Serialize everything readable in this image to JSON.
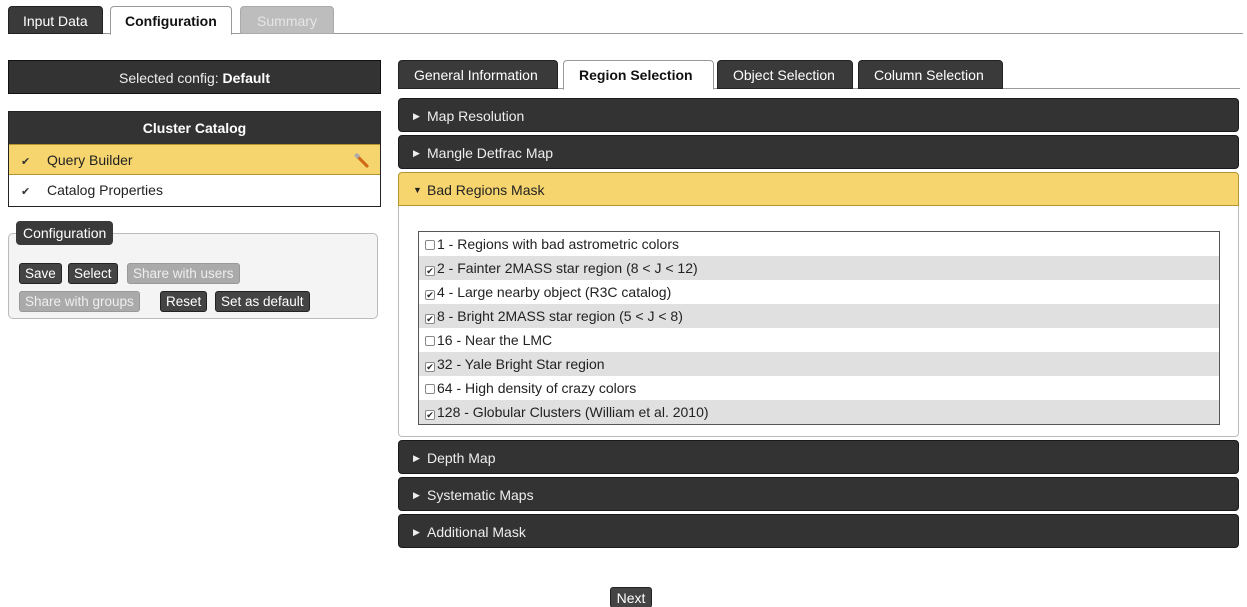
{
  "top_tabs": [
    {
      "label": "Input Data"
    },
    {
      "label": "Configuration"
    },
    {
      "label": "Summary"
    }
  ],
  "selected_config": {
    "prefix": "Selected config:",
    "name": "Default"
  },
  "catalog": {
    "title": "Cluster Catalog",
    "items": [
      {
        "label": "Query Builder",
        "checked": true,
        "active": true,
        "icon": "wrench-icon"
      },
      {
        "label": "Catalog Properties",
        "checked": true,
        "active": false
      }
    ]
  },
  "configuration": {
    "legend": "Configuration",
    "buttons": {
      "save": "Save",
      "select": "Select",
      "share_users": "Share with users",
      "share_groups": "Share with groups",
      "reset": "Reset",
      "set_default": "Set as default"
    }
  },
  "sub_tabs": [
    {
      "label": "General Information"
    },
    {
      "label": "Region Selection"
    },
    {
      "label": "Object Selection"
    },
    {
      "label": "Column Selection"
    }
  ],
  "accordion": [
    {
      "label": "Map Resolution",
      "open": false
    },
    {
      "label": "Mangle Detfrac Map",
      "open": false
    },
    {
      "label": "Bad Regions Mask",
      "open": true
    },
    {
      "label": "Depth Map",
      "open": false
    },
    {
      "label": "Systematic Maps",
      "open": false
    },
    {
      "label": "Additional Mask",
      "open": false
    }
  ],
  "bad_regions": [
    {
      "label": "1 - Regions with bad astrometric colors",
      "checked": false
    },
    {
      "label": "2 - Fainter 2MASS star region (8 < J < 12)",
      "checked": true
    },
    {
      "label": "4 - Large nearby object (R3C catalog)",
      "checked": true
    },
    {
      "label": "8 - Bright 2MASS star region (5 < J < 8)",
      "checked": true
    },
    {
      "label": "16 - Near the LMC",
      "checked": false
    },
    {
      "label": "32 - Yale Bright Star region",
      "checked": true
    },
    {
      "label": "64 - High density of crazy colors",
      "checked": false
    },
    {
      "label": "128 - Globular Clusters (William et al. 2010)",
      "checked": true
    }
  ],
  "footer": {
    "next": "Next"
  },
  "colors": {
    "accent": "#f6d56e",
    "dark": "#333333"
  }
}
